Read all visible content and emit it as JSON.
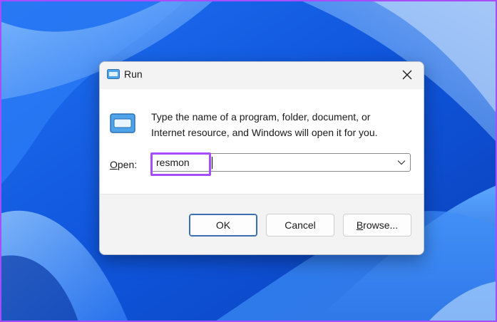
{
  "dialog": {
    "title": "Run",
    "title_icon": "run-icon",
    "close_icon": "close-icon",
    "description_line1": "Type the name of a program, folder, document, or",
    "description_line2": "Internet resource, and Windows will open it for you.",
    "open_label_accel": "O",
    "open_label_rest": "pen:",
    "open_value": "resmon",
    "dropdown_icon": "chevron-down-icon",
    "buttons": {
      "ok": "OK",
      "cancel": "Cancel",
      "browse_accel": "B",
      "browse_rest": "rowse..."
    }
  },
  "colors": {
    "highlight": "#a64dff",
    "wallpaper_base": "#1565e8",
    "ok_border": "#3a6fb5"
  }
}
